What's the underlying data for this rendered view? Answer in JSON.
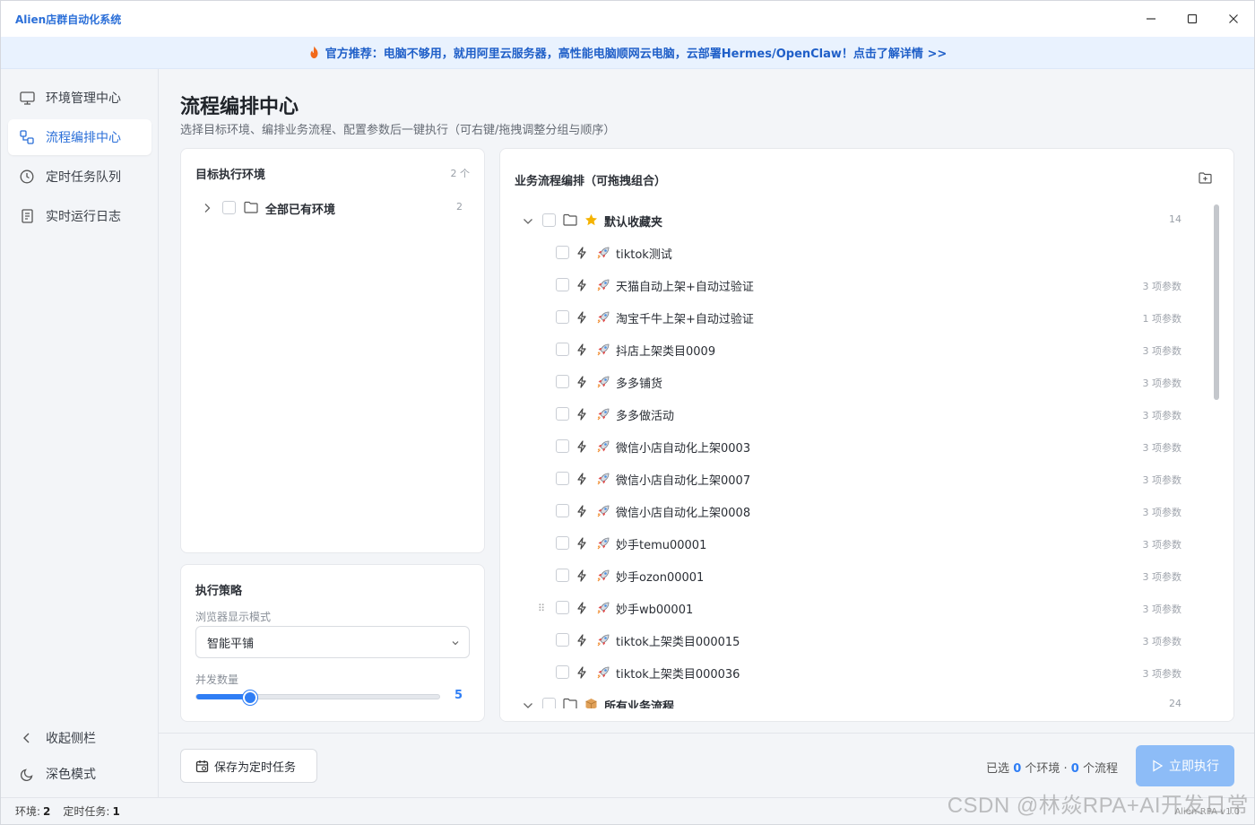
{
  "window": {
    "title": "Alien店群自动化系统"
  },
  "banner": {
    "text": "官方推荐：电脑不够用，就用阿里云服务器，高性能电脑顺网云电脑，云部署Hermes/OpenClaw！点击了解详情 >>"
  },
  "sidebar": {
    "items": [
      {
        "label": "环境管理中心",
        "icon": "monitor-icon"
      },
      {
        "label": "流程编排中心",
        "icon": "flow-icon",
        "active": true
      },
      {
        "label": "定时任务队列",
        "icon": "clock-icon"
      },
      {
        "label": "实时运行日志",
        "icon": "log-icon"
      }
    ],
    "collapse_label": "收起侧栏",
    "dark_mode_label": "深色模式"
  },
  "main": {
    "title": "流程编排中心",
    "subtitle": "选择目标环境、编排业务流程、配置参数后一键执行（可右键/拖拽调整分组与顺序）"
  },
  "env_panel": {
    "title": "目标执行环境",
    "count": "2 个",
    "group": {
      "label": "全部已有环境",
      "count": "2"
    }
  },
  "strategy": {
    "title": "执行策略",
    "browser_mode_label": "浏览器显示模式",
    "browser_mode_value": "智能平铺",
    "concurrency_label": "并发数量",
    "concurrency_value": "5",
    "concurrency_fraction": 0.22
  },
  "flows": {
    "title": "业务流程编排（可拖拽组合）",
    "folders": [
      {
        "label": "默认收藏夹",
        "count": "14",
        "icon": "star-icon"
      },
      {
        "label": "所有业务流程",
        "count": "24",
        "icon": "box-icon"
      }
    ],
    "items": [
      {
        "name": "tiktok测试",
        "params": ""
      },
      {
        "name": "天猫自动上架+自动过验证",
        "params": "3 项参数"
      },
      {
        "name": "淘宝千牛上架+自动过验证",
        "params": "1 项参数"
      },
      {
        "name": "抖店上架类目0009",
        "params": "3 项参数"
      },
      {
        "name": "多多铺货",
        "params": "3 项参数"
      },
      {
        "name": "多多做活动",
        "params": "3 项参数"
      },
      {
        "name": "微信小店自动化上架0003",
        "params": "3 项参数"
      },
      {
        "name": "微信小店自动化上架0007",
        "params": "3 项参数"
      },
      {
        "name": "微信小店自动化上架0008",
        "params": "3 项参数"
      },
      {
        "name": "妙手temu00001",
        "params": "3 项参数"
      },
      {
        "name": "妙手ozon00001",
        "params": "3 项参数"
      },
      {
        "name": "妙手wb00001",
        "params": "3 项参数"
      },
      {
        "name": "tiktok上架类目000015",
        "params": "3 项参数"
      },
      {
        "name": "tiktok上架类目000036",
        "params": "3 项参数"
      }
    ]
  },
  "actions": {
    "save_label": "保存为定时任务",
    "selected_prefix": "已选",
    "selected_env": "0",
    "selected_mid": "个环境 · ",
    "selected_flow": "0",
    "selected_suffix": "个流程",
    "run_label": "立即执行"
  },
  "status": {
    "env_label": "环境:",
    "env_value": "2",
    "task_label": "定时任务:",
    "task_value": "1",
    "version": "Alien-RPA v1.0"
  },
  "watermark": "CSDN @林焱RPA+AI开发日常",
  "colors": {
    "accent": "#2f7ef5",
    "brand": "#2b6fd8",
    "banner_bg": "#e9f2fe",
    "run_disabled": "#8dbcf7"
  }
}
